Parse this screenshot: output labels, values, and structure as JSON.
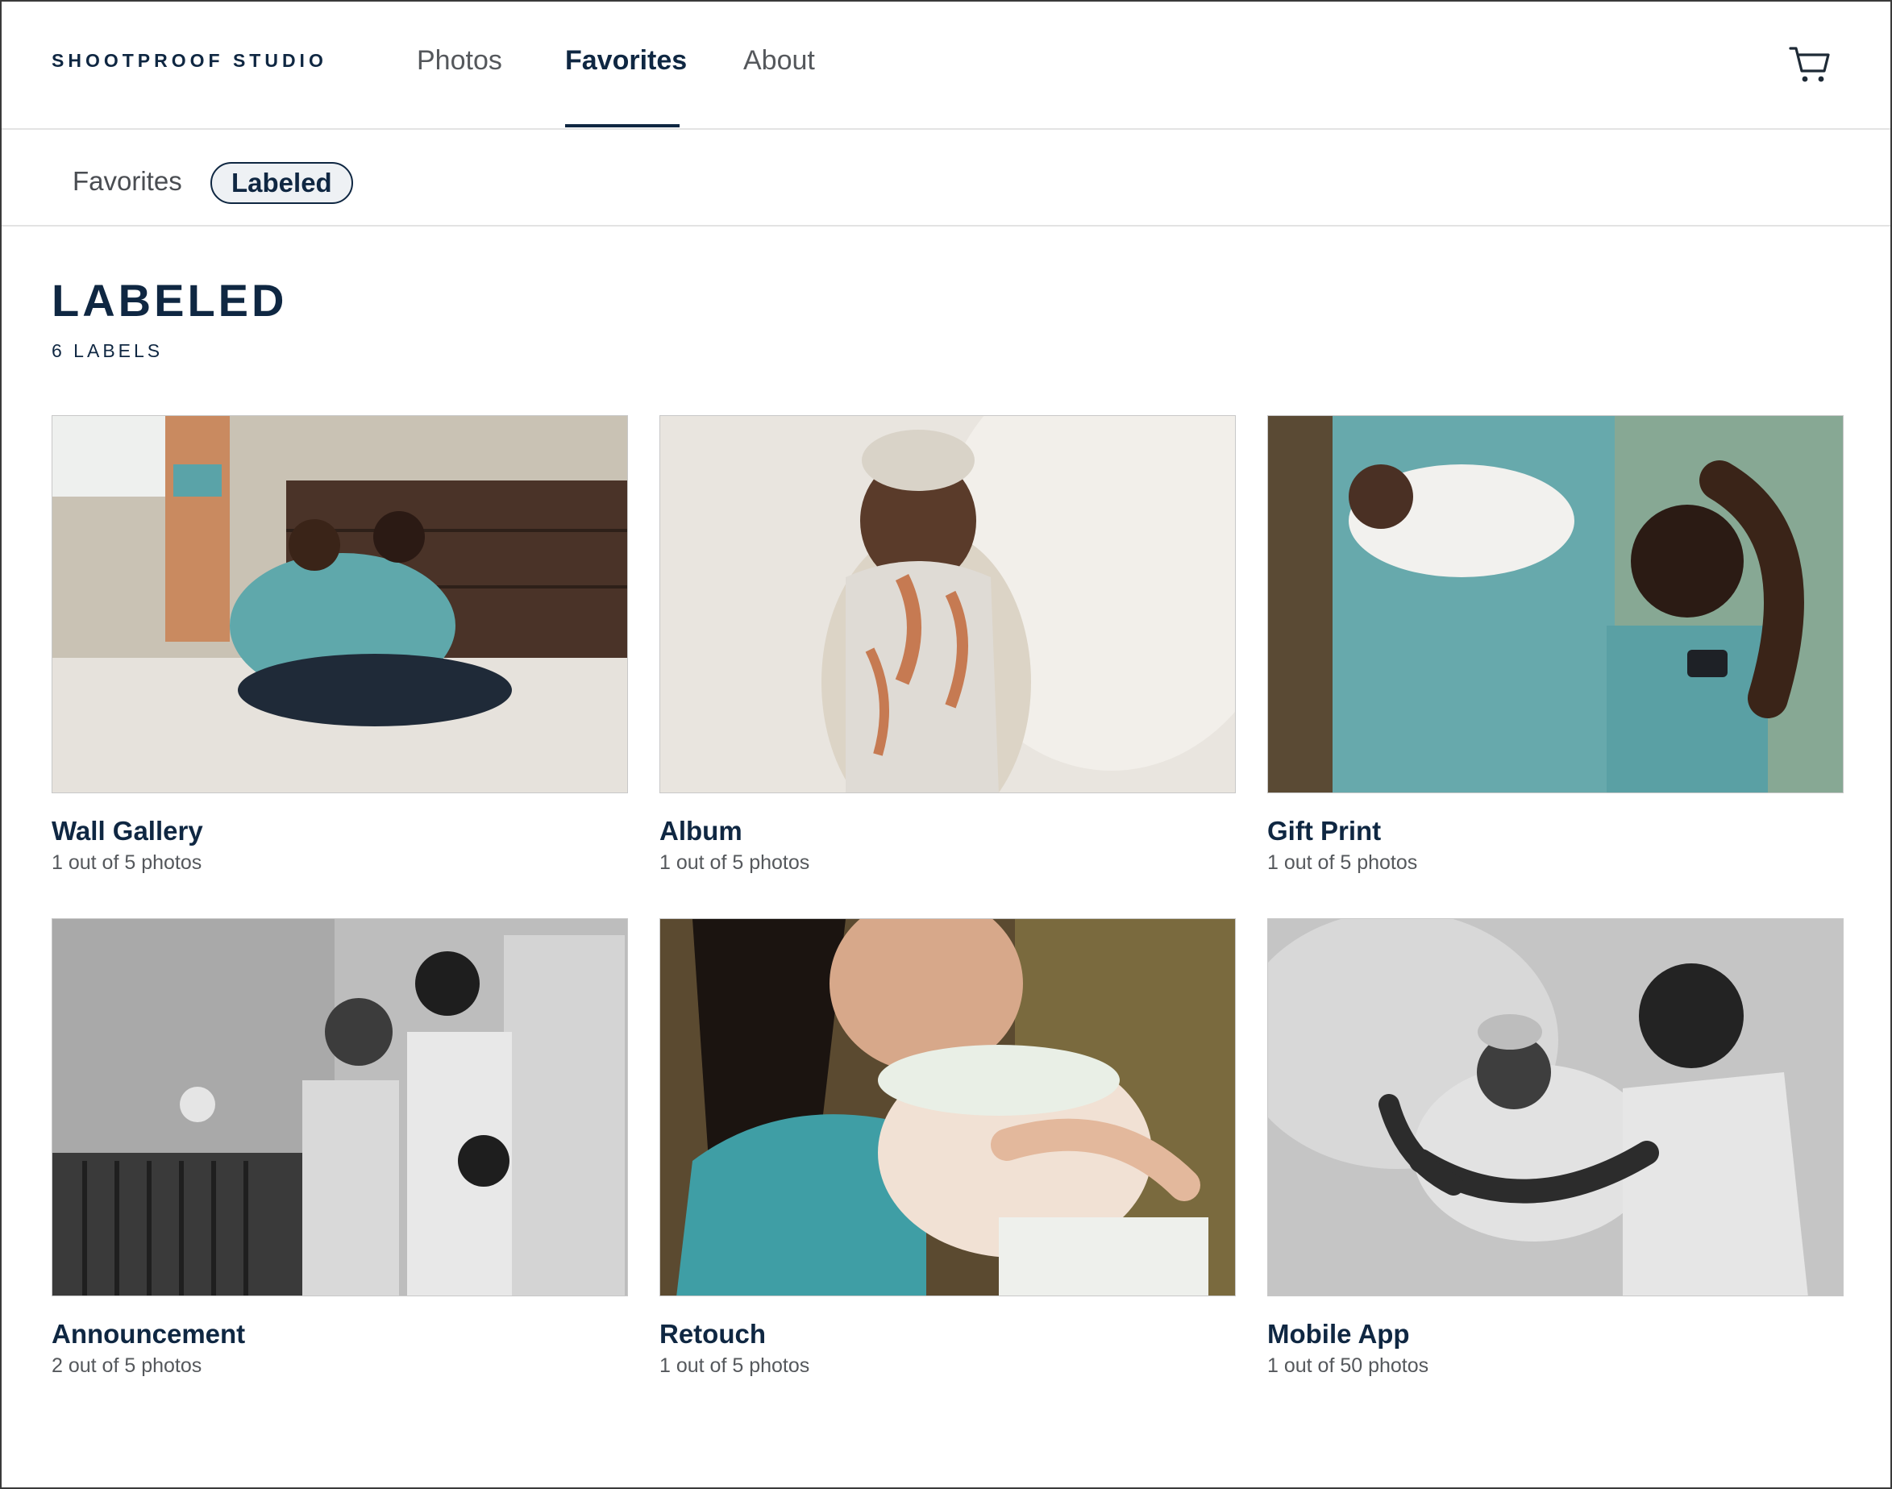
{
  "brand": "SHOOTPROOF STUDIO",
  "nav": {
    "tabs": [
      {
        "label": "Photos"
      },
      {
        "label": "Favorites"
      },
      {
        "label": "About"
      }
    ],
    "active": "Favorites",
    "cart_icon": "shopping-cart-icon"
  },
  "subnav": {
    "tabs": [
      {
        "label": "Favorites"
      },
      {
        "label": "Labeled"
      }
    ],
    "active": "Labeled"
  },
  "page": {
    "title": "LABELED",
    "count": "6 LABELS"
  },
  "labels": [
    {
      "name": "Wall Gallery",
      "count": "1 out of 5 photos"
    },
    {
      "name": "Album",
      "count": "1 out of 5 photos"
    },
    {
      "name": "Gift Print",
      "count": "1 out of 5 photos"
    },
    {
      "name": "Announcement",
      "count": "2 out of 5 photos"
    },
    {
      "name": "Retouch",
      "count": "1 out of 5 photos"
    },
    {
      "name": "Mobile App",
      "count": "1 out of 50 photos"
    }
  ],
  "colors": {
    "brand_navy": "#0f2742",
    "text_gray": "#55585c",
    "divider": "#e3e3e3"
  }
}
